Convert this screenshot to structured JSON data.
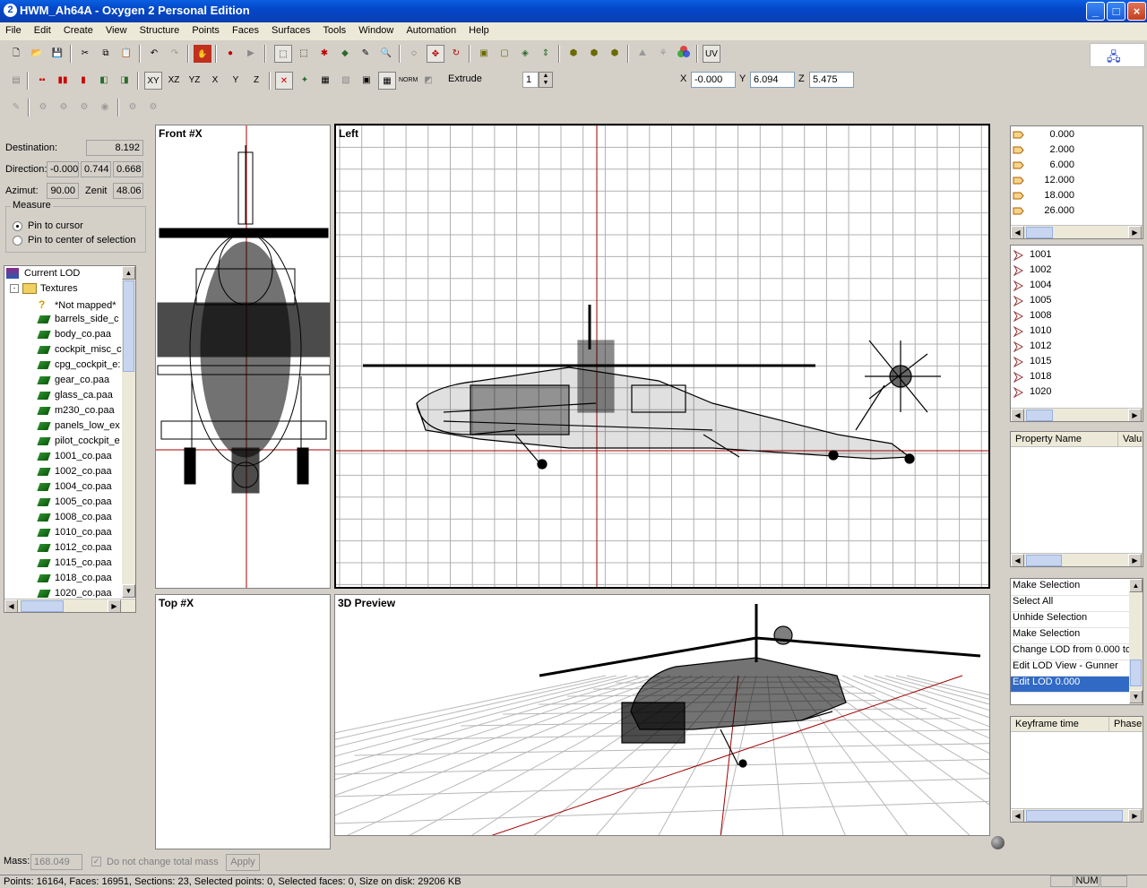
{
  "window": {
    "title": "HWM_Ah64A - Oxygen 2 Personal Edition"
  },
  "menu": [
    "File",
    "Edit",
    "Create",
    "View",
    "Structure",
    "Points",
    "Faces",
    "Surfaces",
    "Tools",
    "Window",
    "Automation",
    "Help"
  ],
  "toolbar": {
    "extrude_label": "Extrude",
    "extrude_value": "1",
    "plane_buttons": [
      "XY",
      "XZ",
      "YZ",
      "X",
      "Y",
      "Z"
    ],
    "uv_label": "UV",
    "x_label": "X",
    "x_value": "-0.000",
    "y_label": "Y",
    "y_value": "6.094",
    "z_label": "Z",
    "z_value": "5.475"
  },
  "measure": {
    "destination_label": "Destination:",
    "destination_value": "8.192",
    "direction_label": "Direction:",
    "direction_values": [
      "-0.000",
      "0.744",
      "0.668"
    ],
    "azimut_label": "Azimut:",
    "azimut_value": "90.00",
    "zenit_label": "Zenit",
    "zenit_value": "48.06",
    "group_label": "Measure",
    "option_cursor": "Pin to cursor",
    "option_center": "Pin to center of selection"
  },
  "tree": {
    "root": "Current LOD",
    "folder": "Textures",
    "items": [
      "*Not mapped*",
      "barrels_side_c",
      "body_co.paa",
      "cockpit_misc_c",
      "cpg_cockpit_e:",
      "gear_co.paa",
      "glass_ca.paa",
      "m230_co.paa",
      "panels_low_ex",
      "pilot_cockpit_e",
      "1001_co.paa",
      "1002_co.paa",
      "1004_co.paa",
      "1005_co.paa",
      "1008_co.paa",
      "1010_co.paa",
      "1012_co.paa",
      "1015_co.paa",
      "1018_co.paa",
      "1020_co.paa"
    ]
  },
  "viewports": {
    "front": "Front #X",
    "left": "Left",
    "top": "Top #X",
    "preview": "3D Preview"
  },
  "lod_resolutions": [
    "0.000",
    "2.000",
    "6.000",
    "12.000",
    "18.000",
    "26.000"
  ],
  "selections": [
    "1001",
    "1002",
    "1004",
    "1005",
    "1008",
    "1010",
    "1012",
    "1015",
    "1018",
    "1020"
  ],
  "properties": {
    "col_name": "Property Name",
    "col_value": "Valu"
  },
  "history": [
    "Make Selection",
    "Select All",
    "Unhide Selection",
    "Make Selection",
    "Change LOD from  0.000 to",
    "Edit LOD View - Gunner",
    "Edit LOD   0.000"
  ],
  "keyframes": {
    "col_time": "Keyframe time",
    "col_phase": "Phase"
  },
  "mass": {
    "label": "Mass:",
    "value": "168.049",
    "checkbox_label": "Do not change total mass",
    "apply_label": "Apply"
  },
  "status": {
    "text": "Points: 16164, Faces: 16951, Sections: 23, Selected points: 0, Selected faces: 0, Size on disk: 29206 KB",
    "num": "NUM"
  },
  "colors": {
    "title_bar": "#0347c9",
    "selection_highlight": "#316ac5",
    "axis_line": "#a00000"
  }
}
